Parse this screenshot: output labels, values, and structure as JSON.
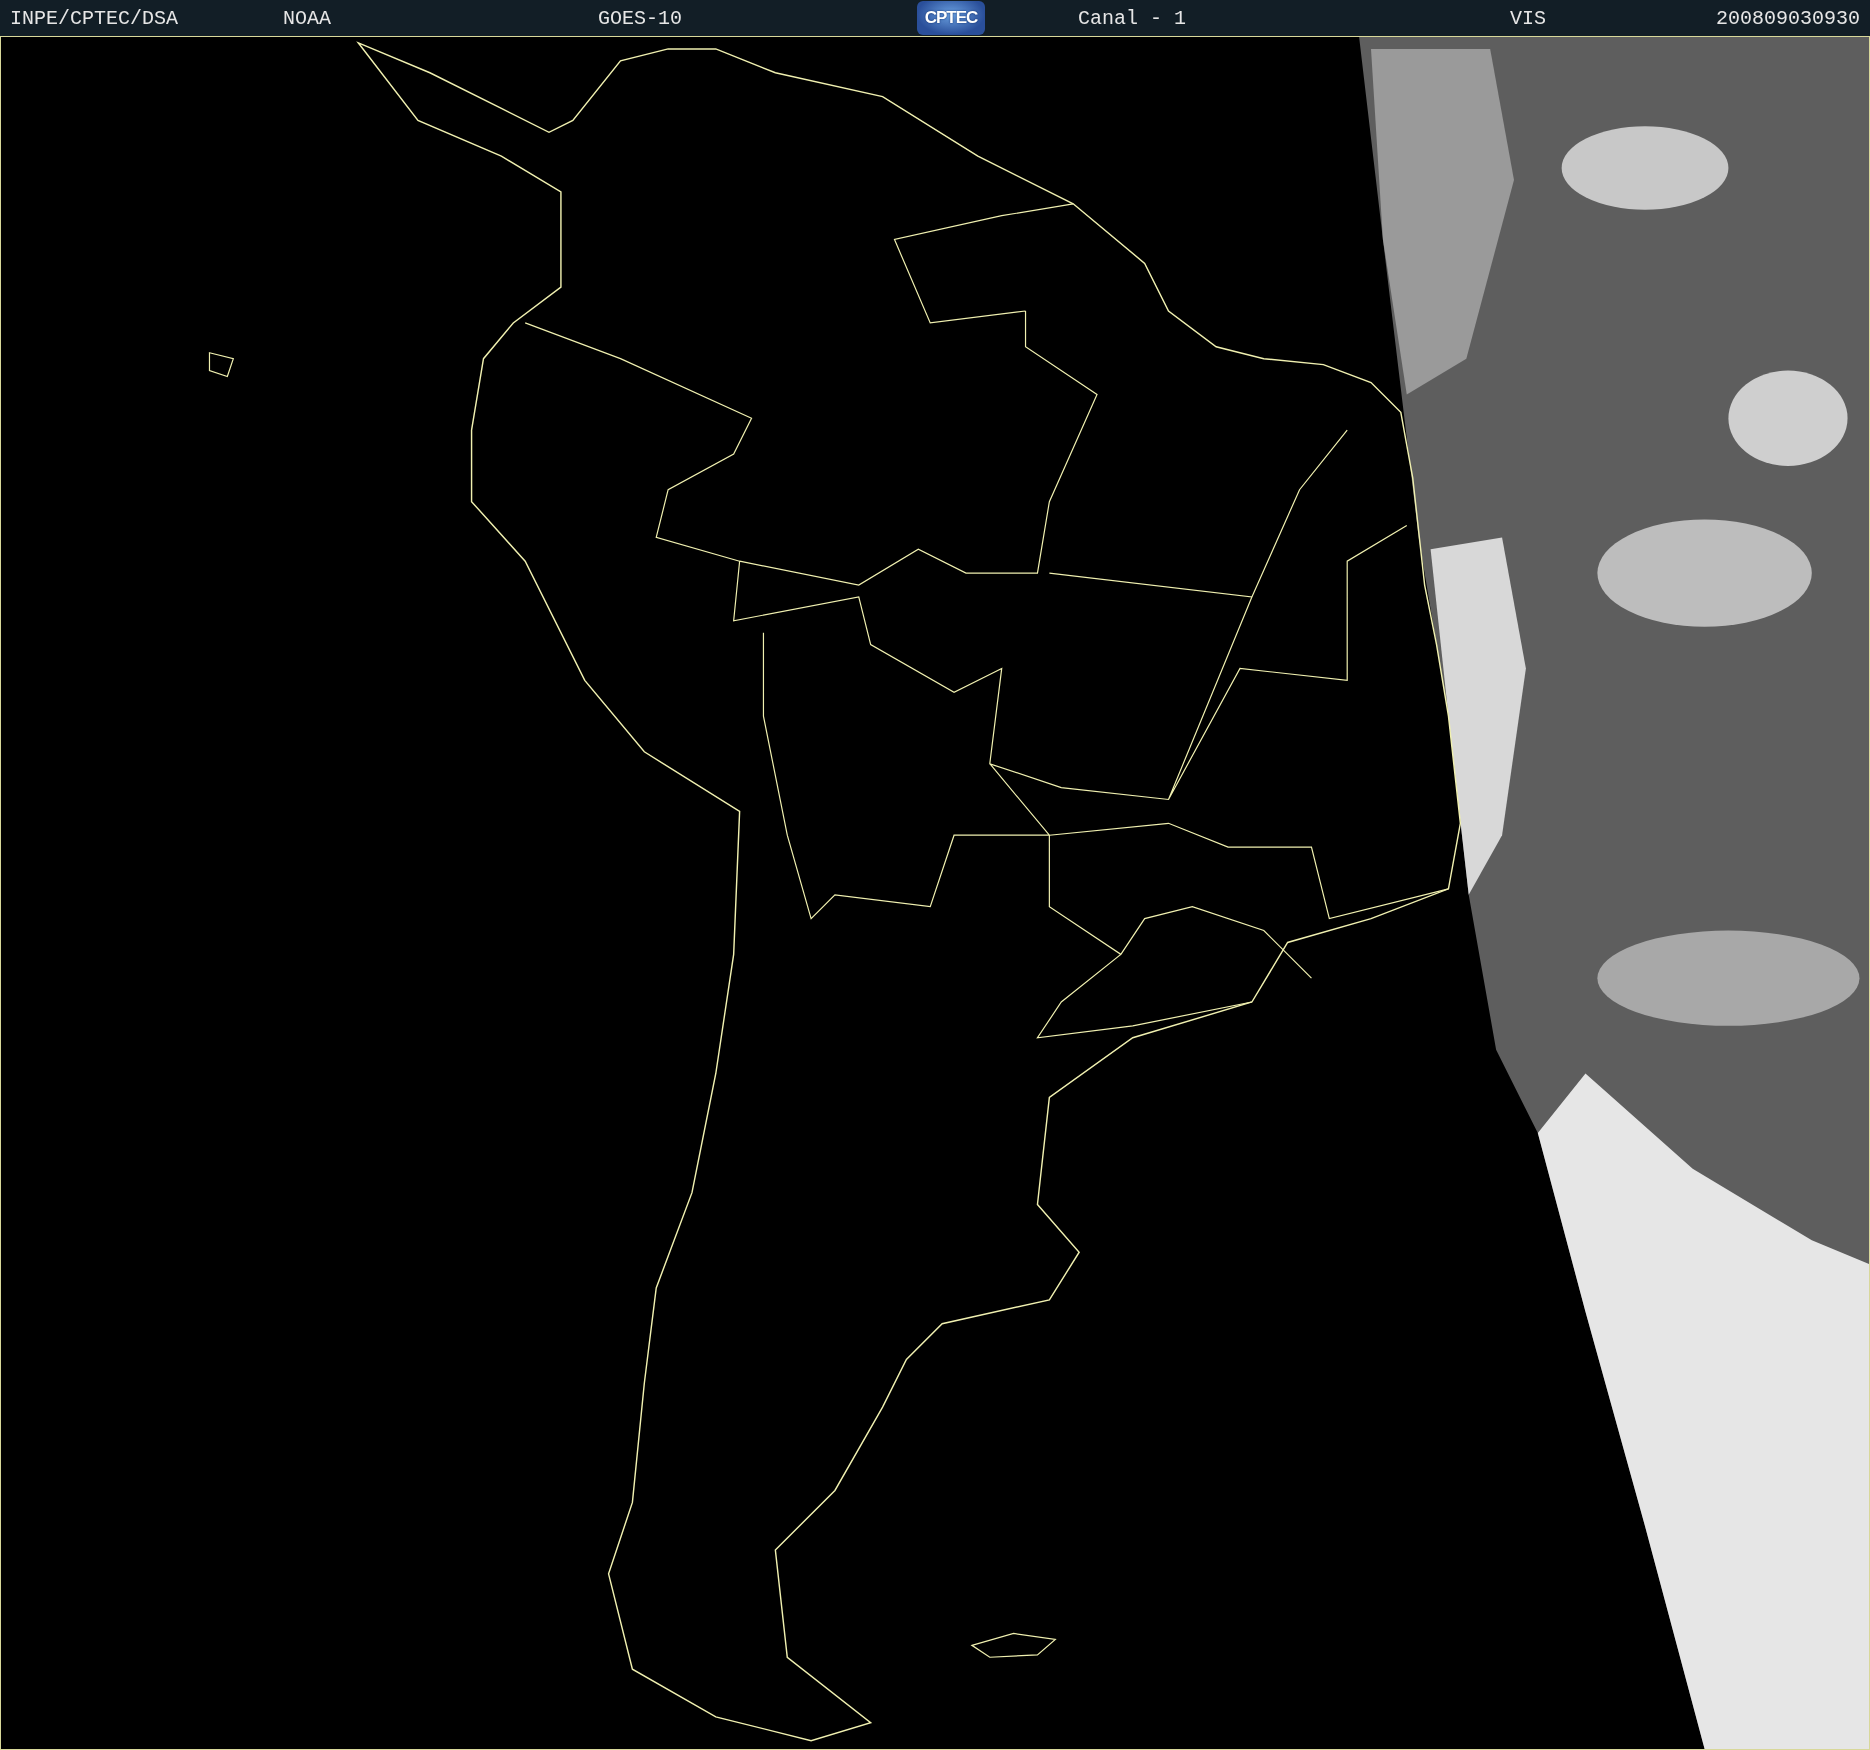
{
  "header": {
    "items": [
      {
        "kind": "text",
        "text": "INPE/CPTEC/DSA"
      },
      {
        "kind": "text",
        "text": "NOAA"
      },
      {
        "kind": "text",
        "text": "GOES-10"
      },
      {
        "kind": "logo",
        "text": "CPTEC"
      },
      {
        "kind": "text",
        "text": "Canal - 1"
      },
      {
        "kind": "text",
        "text": "VIS"
      },
      {
        "kind": "text",
        "text": "200809030930"
      }
    ]
  }
}
